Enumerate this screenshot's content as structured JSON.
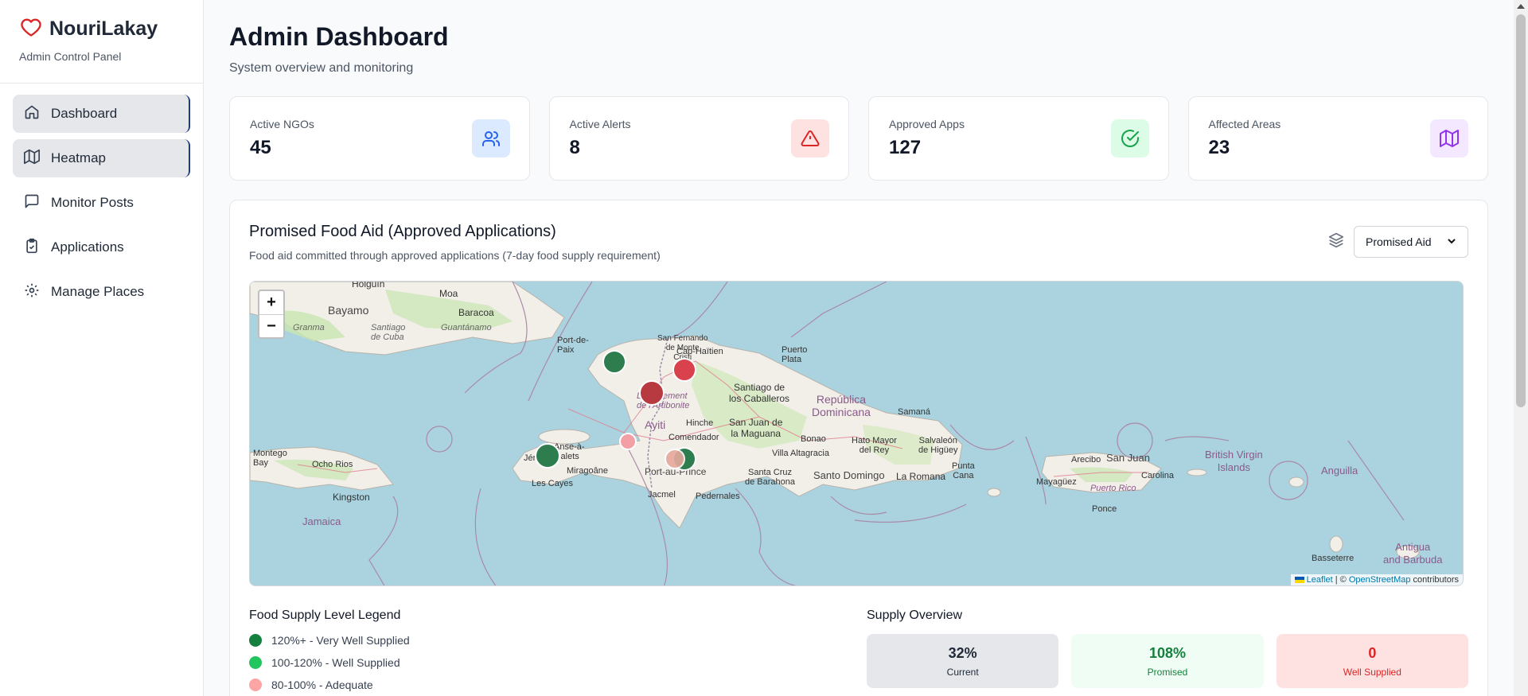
{
  "brand": {
    "name": "NouriLakay",
    "subtitle": "Admin Control Panel",
    "accent": "#dc2626"
  },
  "nav": [
    {
      "label": "Dashboard",
      "icon": "home-icon",
      "active": true
    },
    {
      "label": "Heatmap",
      "icon": "map-icon",
      "active": true
    },
    {
      "label": "Monitor Posts",
      "icon": "message-square-icon",
      "active": false
    },
    {
      "label": "Applications",
      "icon": "clipboard-check-icon",
      "active": false
    },
    {
      "label": "Manage Places",
      "icon": "gear-icon",
      "active": false
    }
  ],
  "header": {
    "title": "Admin Dashboard",
    "subtitle": "System overview and monitoring"
  },
  "stats": [
    {
      "label": "Active NGOs",
      "value": "45",
      "icon": "users-icon",
      "color": "#2563eb",
      "bg": "#dbeafe"
    },
    {
      "label": "Active Alerts",
      "value": "8",
      "icon": "alert-triangle-icon",
      "color": "#dc2626",
      "bg": "#fee2e2"
    },
    {
      "label": "Approved Apps",
      "value": "127",
      "icon": "check-circle-icon",
      "color": "#16a34a",
      "bg": "#dcfce7"
    },
    {
      "label": "Affected Areas",
      "value": "23",
      "icon": "map-icon",
      "color": "#9333ea",
      "bg": "#f3e8ff"
    }
  ],
  "food_aid": {
    "title": "Promised Food Aid (Approved Applications)",
    "subtitle": "Food aid committed through approved applications (7-day food supply requirement)",
    "select_value": "Promised Aid"
  },
  "map": {
    "zoom_in": "+",
    "zoom_out": "−",
    "attribution": {
      "leaflet": "Leaflet",
      "sep": " | © ",
      "osm": "OpenStreetMap",
      "suffix": " contributors"
    },
    "places": {
      "holguin": "Holguín",
      "moa": "Moa",
      "bayamo": "Bayamo",
      "baracoa": "Baracoa",
      "granma": "Granma",
      "santiago_cuba": "Santiago\nde Cuba",
      "guantanamo": "Guantánamo",
      "port_de_paix": "Port-de-\nPaix",
      "cap_haitien": "Cap-Haïtien",
      "san_fernando": "San Fernando\nde Monte\nCristi",
      "puerto_plata": "Puerto\nPlata",
      "santiago_caballeros": "Santiago de\nlos Caballeros",
      "rep_dom": "República\nDominicana",
      "artibonite": "Département\nde l'Artibonite",
      "ayiti": "Ayiti",
      "hinche": "Hinche",
      "san_juan_maguana": "San Juan de\nla Maguana",
      "samana": "Samaná",
      "comendador": "Comendador",
      "bonao": "Bonao",
      "hato_mayor": "Hato Mayor\ndel Rey",
      "salvaleon": "Salvaleón\nde Higüey",
      "villa_altagracia": "Villa Altagracia",
      "anse_a_galets": "Anse-à-\nGalets",
      "jeremie": "Jérémie",
      "miragoane": "Miragoâne",
      "port_au_prince": "Port-au-Prince",
      "les_cayes": "Les Cayes",
      "jacmel": "Jacmel",
      "pedernales": "Pedernales",
      "santa_cruz": "Santa Cruz\nde Barahona",
      "santo_domingo": "Santo Domingo",
      "la_romana": "La Romana",
      "punta_cana": "Punta\nCana",
      "montego": "Montego\nBay",
      "ocho_rios": "Ocho Rios",
      "kingston": "Kingston",
      "jamaica": "Jamaica",
      "arecibo": "Arecibo",
      "san_juan": "San Juan",
      "carolina": "Carolina",
      "mayaguez": "Mayagüez",
      "puerto_rico": "Puerto Rico",
      "ponce": "Ponce",
      "bvi": "British Virgin\nIslands",
      "anguilla": "Anguilla",
      "basseterre": "Basseterre",
      "antigua": "Antigua\nand Barbuda"
    }
  },
  "legend": {
    "title": "Food Supply Level Legend",
    "items": [
      {
        "label": "120%+ - Very Well Supplied",
        "color": "#15803d"
      },
      {
        "label": "100-120% - Well Supplied",
        "color": "#22c55e"
      },
      {
        "label": "80-100% - Adequate",
        "color": "#fca5a5"
      }
    ]
  },
  "supply": {
    "title": "Supply Overview",
    "items": [
      {
        "value": "32%",
        "label": "Current",
        "bg": "#e5e7eb",
        "color": "#1f2937"
      },
      {
        "value": "108%",
        "label": "Promised",
        "bg": "#f0fdf4",
        "color": "#15803d"
      },
      {
        "value": "0",
        "label": "Well Supplied",
        "bg": "#fee2e2",
        "color": "#dc2626"
      }
    ]
  }
}
